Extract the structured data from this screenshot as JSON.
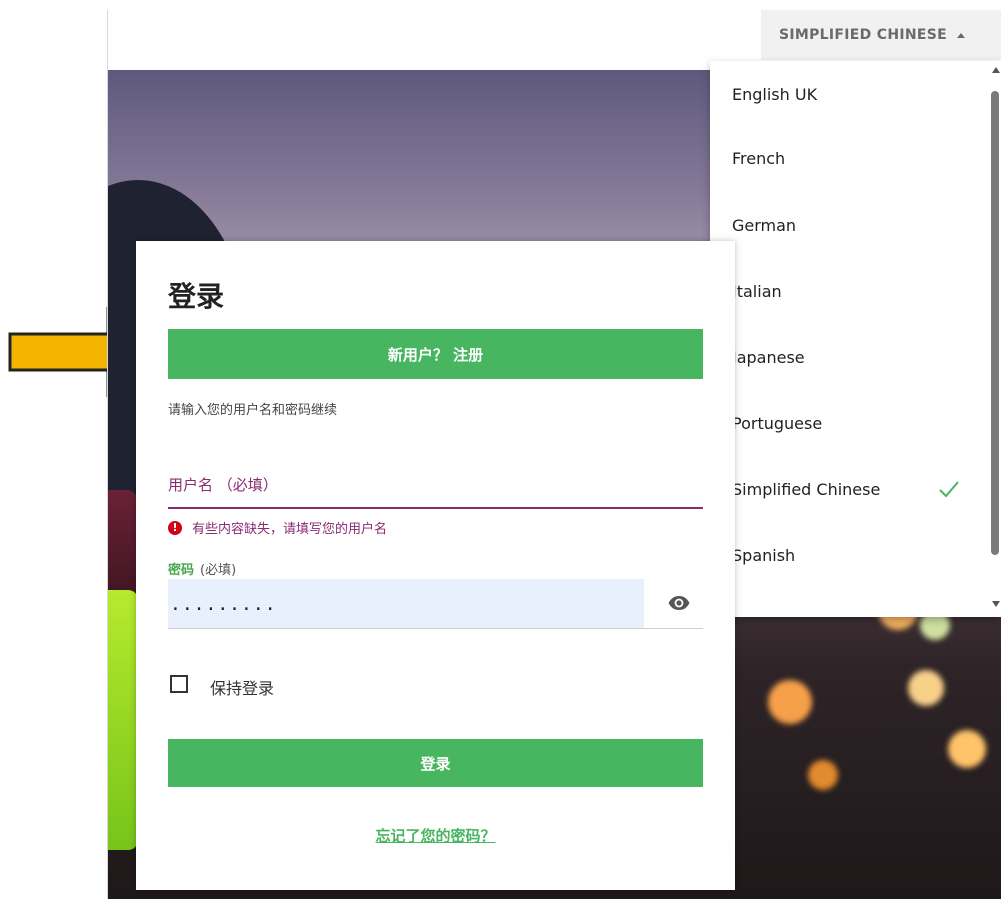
{
  "language_selector": {
    "current": "SIMPLIFIED CHINESE",
    "options": [
      {
        "label": "English UK"
      },
      {
        "label": "French"
      },
      {
        "label": "German"
      },
      {
        "label": "Italian"
      },
      {
        "label": "Japanese"
      },
      {
        "label": "Portuguese"
      },
      {
        "label": "Simplified Chinese",
        "selected": true
      },
      {
        "label": "Spanish"
      }
    ]
  },
  "login": {
    "title": "登录",
    "register_button": "新用户？ 注册",
    "hint": "请输入您的用户名和密码继续",
    "username_label": "用户名 （必填）",
    "username_error": "有些内容缺失，请填写您的用户名",
    "error_icon_glyph": "!",
    "password_label": "密码",
    "password_required": "(必填)",
    "password_value": ".........",
    "remember_me": "保持登录",
    "login_button": "登录",
    "forgot_password": "忘记了您的密码？"
  },
  "colors": {
    "primary_green": "#48b560",
    "error_purple": "#8d2a73",
    "annotation_arrow": "#f5b400"
  },
  "icons": {
    "show_password": "eye-icon",
    "selected_check": "check-icon",
    "error": "error-icon",
    "dropdown_caret": "caret-up-icon"
  }
}
